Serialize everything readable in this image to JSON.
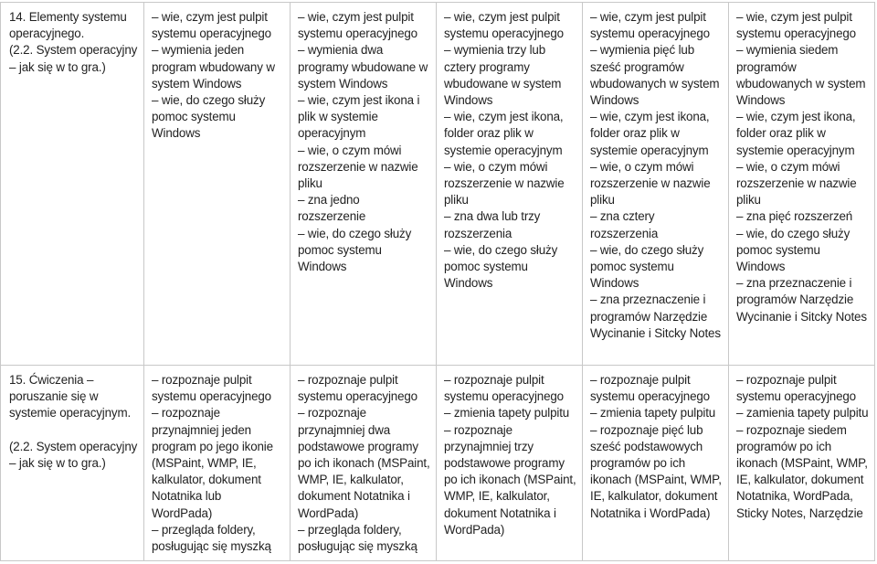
{
  "table": {
    "rows": [
      {
        "topic": "14. Elementy systemu operacyjnego.\n(2.2. System operacyjny\n– jak się w to gra.)",
        "levels": [
          "– wie, czym jest pulpit systemu operacyjnego\n– wymienia jeden program wbudowany w system Windows\n– wie, do czego służy pomoc systemu Windows",
          "– wie, czym jest pulpit systemu operacyjnego\n– wymienia dwa programy wbudowane w system Windows\n– wie, czym jest ikona i plik w systemie operacyjnym\n– wie, o czym mówi rozszerzenie w nazwie pliku\n– zna jedno rozszerzenie\n– wie, do czego służy pomoc systemu Windows",
          "– wie, czym jest pulpit systemu operacyjnego\n– wymienia trzy lub cztery programy wbudowane w system Windows\n– wie, czym jest ikona, folder oraz plik w systemie operacyjnym\n– wie, o czym mówi rozszerzenie w nazwie pliku\n– zna dwa lub trzy rozszerzenia\n– wie, do czego służy pomoc systemu Windows",
          "– wie, czym jest pulpit systemu operacyjnego\n– wymienia pięć lub sześć programów wbudowanych w system Windows\n– wie, czym jest ikona, folder oraz plik w systemie operacyjnym\n– wie, o czym mówi rozszerzenie w nazwie pliku\n– zna cztery rozszerzenia\n– wie, do czego służy pomoc systemu Windows\n– zna przeznaczenie i programów Narzędzie Wycinanie i Sitcky Notes",
          "– wie, czym jest pulpit systemu operacyjnego\n– wymienia siedem programów wbudowanych w system Windows\n– wie, czym jest ikona, folder oraz plik w systemie operacyjnym\n– wie, o czym mówi rozszerzenie w nazwie pliku\n– zna pięć rozszerzeń\n– wie, do czego służy pomoc systemu Windows\n– zna przeznaczenie i programów Narzędzie Wycinanie i Sitcky Notes"
        ]
      },
      {
        "topic": "15. Ćwiczenia – poruszanie się w systemie operacyjnym.\n\n(2.2. System operacyjny\n– jak się w to gra.)",
        "levels": [
          "– rozpoznaje pulpit systemu operacyjnego\n– rozpoznaje przynajmniej jeden program po jego ikonie (MSPaint, WMP, IE, kalkulator, dokument Notatnika lub WordPada)\n– przegląda foldery, posługując się myszką",
          "– rozpoznaje pulpit systemu operacyjnego\n– rozpoznaje przynajmniej dwa podstawowe programy po ich ikonach (MSPaint, WMP, IE, kalkulator, dokument Notatnika i WordPada)\n– przegląda foldery, posługując się myszką",
          "– rozpoznaje pulpit systemu operacyjnego\n– zmienia tapety pulpitu\n– rozpoznaje przynajmniej trzy podstawowe programy po ich ikonach (MSPaint, WMP, IE, kalkulator, dokument Notatnika i WordPada)",
          "– rozpoznaje pulpit systemu operacyjnego\n– zmienia tapety pulpitu\n– rozpoznaje pięć lub sześć podstawowych programów po ich ikonach (MSPaint, WMP, IE, kalkulator, dokument Notatnika i WordPada)",
          "– rozpoznaje pulpit systemu operacyjnego\n– zamienia tapety pulpitu\n– rozpoznaje siedem programów po ich ikonach (MSPaint, WMP, IE, kalkulator, dokument Notatnika, WordPada, Sticky Notes, Narzędzie"
        ]
      }
    ]
  }
}
